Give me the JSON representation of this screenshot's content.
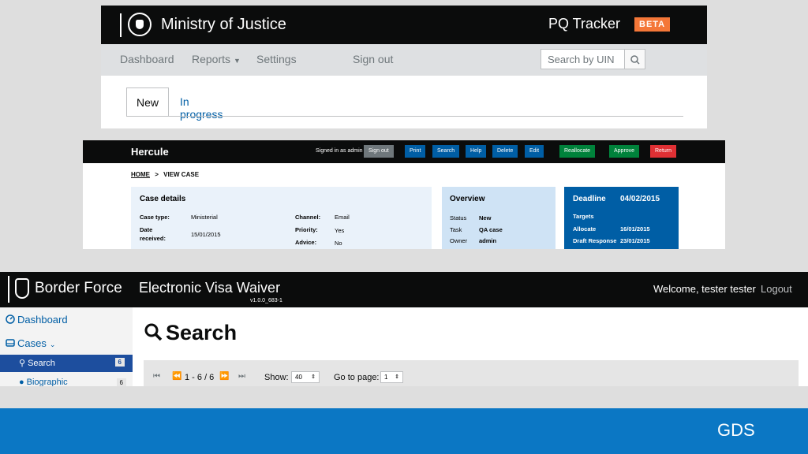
{
  "pq": {
    "brand": "Ministry of Justice",
    "app_title": "PQ Tracker",
    "beta": "BETA",
    "nav": [
      "Dashboard",
      "Reports",
      "Settings",
      "Sign out"
    ],
    "search_placeholder": "Search by UIN",
    "tabs": [
      "New",
      "In progress"
    ]
  },
  "hercule": {
    "title": "Hercule",
    "signed_in": "Signed in as admin",
    "buttons": [
      {
        "label": "Sign out",
        "color": "#6f777b"
      },
      {
        "label": "Print",
        "color": "#005ea5"
      },
      {
        "label": "Search",
        "color": "#005ea5"
      },
      {
        "label": "Help",
        "color": "#005ea5"
      },
      {
        "label": "Delete",
        "color": "#005ea5"
      },
      {
        "label": "Edit",
        "color": "#005ea5"
      },
      {
        "label": "Reallocate",
        "color": "#00823b"
      },
      {
        "label": "Approve",
        "color": "#00823b"
      },
      {
        "label": "Return",
        "color": "#df3034"
      }
    ],
    "breadcrumb_home": "HOME",
    "breadcrumb_sep": ">",
    "breadcrumb_current": "VIEW CASE",
    "case_details": {
      "heading": "Case details",
      "case_type_label": "Case type:",
      "case_type": "Ministerial",
      "date_received_label_1": "Date",
      "date_received_label_2": "received:",
      "date_received": "15/01/2015",
      "channel_label": "Channel:",
      "channel": "Email",
      "priority_label": "Priority:",
      "priority": "Yes",
      "advice_label": "Advice:",
      "advice": "No"
    },
    "overview": {
      "heading": "Overview",
      "status_label": "Status",
      "status": "New",
      "task_label": "Task",
      "task": "QA case",
      "owner_label": "Owner",
      "owner": "admin"
    },
    "deadline": {
      "heading": "Deadline",
      "date": "04/02/2015",
      "targets": "Targets",
      "allocate_label": "Allocate",
      "allocate": "16/01/2015",
      "draft_label": "Draft Response",
      "draft": "23/01/2015"
    }
  },
  "border": {
    "brand": "Border Force",
    "app_title": "Electronic Visa Waiver",
    "version": "v1.0.0_683-1",
    "welcome": "Welcome, tester tester",
    "logout": "Logout",
    "sidebar": {
      "dashboard": "Dashboard",
      "cases": "Cases",
      "search": "Search",
      "search_count": "6",
      "biographic": "Biographic",
      "biographic_count": "6"
    },
    "heading": "Search",
    "pager_range": "1 - 6 / 6",
    "show_label": "Show:",
    "show_value": "40",
    "goto_label": "Go to page:",
    "goto_value": "1"
  },
  "footer": {
    "logo": "GDS"
  }
}
